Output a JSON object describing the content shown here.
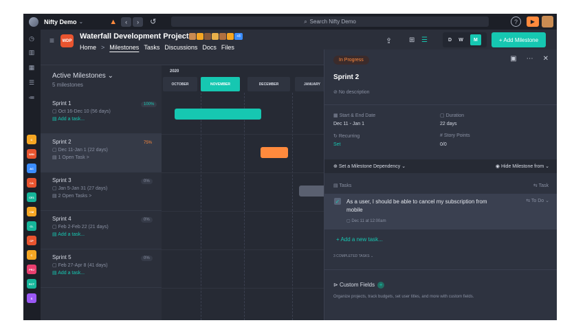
{
  "app": {
    "name": "Nifty Demo",
    "search_placeholder": "Search Nifty Demo",
    "help_icon": "?",
    "record_icon": "▶"
  },
  "project": {
    "badge": "WDP",
    "name": "Waterfall Development Project",
    "extra_badge": "+8",
    "breadcrumb": {
      "home": "Home",
      "sep": ">",
      "current": "Milestones"
    },
    "tabs": [
      "Tasks",
      "Discussions",
      "Docs",
      "Files"
    ],
    "view_scale": {
      "d": "D",
      "w": "W",
      "m": "M",
      "selected": "M"
    },
    "add_milestone": "+ Add Milestone"
  },
  "rail": {
    "projects": [
      {
        "code": "C",
        "color": "#f5a623"
      },
      {
        "code": "WIN",
        "color": "#e8542f"
      },
      {
        "code": "AC",
        "color": "#3b8dff"
      },
      {
        "code": "CA",
        "color": "#e8542f"
      },
      {
        "code": "CE1",
        "color": "#16b59a"
      },
      {
        "code": "CM",
        "color": "#f5a623"
      },
      {
        "code": "CL",
        "color": "#16b59a"
      },
      {
        "code": "CP",
        "color": "#e8542f"
      },
      {
        "code": "C",
        "color": "#f5a623"
      },
      {
        "code": "PRJ",
        "color": "#e83f6f"
      },
      {
        "code": "RCT",
        "color": "#16b59a"
      },
      {
        "code": "S",
        "color": "#9b59f5"
      }
    ]
  },
  "milestones": {
    "title": "Active Milestones",
    "count": "5 milestones",
    "items": [
      {
        "name": "Sprint 1",
        "dates": "Oct 16-Dec 10 (56 days)",
        "tasks": "Add a task...",
        "pct": "100%"
      },
      {
        "name": "Sprint 2",
        "dates": "Dec 11-Jan 1 (22 days)",
        "tasks": "1 Open Task >",
        "pct": "75%"
      },
      {
        "name": "Sprint 3",
        "dates": "Jan 5-Jan 31 (27 days)",
        "tasks": "2 Open Tasks >",
        "pct": "0%"
      },
      {
        "name": "Sprint 4",
        "dates": "Feb 2-Feb 22 (21 days)",
        "tasks": "Add a task...",
        "pct": "0%"
      },
      {
        "name": "Sprint 5",
        "dates": "Feb 27-Apr 8 (41 days)",
        "tasks": "Add a task...",
        "pct": "0%"
      }
    ]
  },
  "gantt": {
    "year": "2020",
    "months": [
      "OCTOBER",
      "NOVEMBER",
      "DECEMBER",
      "JANUARY"
    ],
    "current_month": "NOVEMBER",
    "bar_colors": {
      "sprint1": "#16c7b1",
      "sprint2": "#ff8a3d",
      "sprint3": "#5a6070"
    }
  },
  "detail": {
    "status": "In Progress",
    "name": "Sprint 2",
    "description": "No description",
    "start_end_label": "Start & End Date",
    "start_end_value": "Dec 11 - Jan 1",
    "duration_label": "Duration",
    "duration_value": "22 days",
    "recurring_label": "Recurring",
    "recurring_value": "Set",
    "story_points_label": "Story Points",
    "story_points_value": "0/0",
    "dependency": "Set a Milestone Dependency",
    "hide_from": "Hide Milestone from",
    "tasks_label": "Tasks",
    "task_action": "Task",
    "task": {
      "text": "As a user, I should be able to cancel my subscription from mobile",
      "status": "To Do",
      "date": "Dec 11 at 12:00am"
    },
    "add_task": "+ Add a new task...",
    "completed": "3 COMPLETED TASKS",
    "custom_fields": "Custom Fields",
    "custom_fields_desc": "Organize projects, track budgets, set user titles, and more with custom fields."
  }
}
